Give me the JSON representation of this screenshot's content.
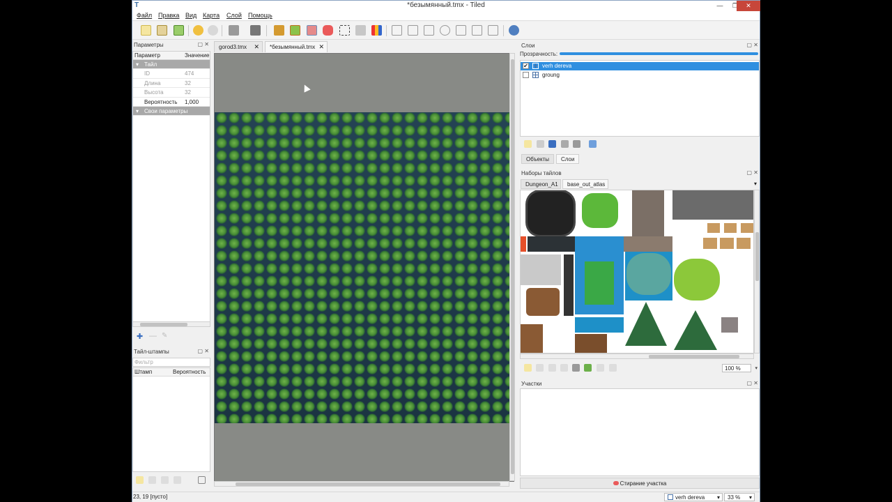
{
  "window": {
    "title": "*безымянный.tmx - Tiled",
    "minimize": "—",
    "maximize": "❐",
    "close": "✕"
  },
  "menu": [
    "Файл",
    "Правка",
    "Вид",
    "Карта",
    "Слой",
    "Помощь"
  ],
  "properties": {
    "title": "Параметры",
    "col_name": "Параметр",
    "col_value": "Значение",
    "group_tile": "Тайл",
    "rows": [
      {
        "name": "ID",
        "value": "474",
        "disabled": true
      },
      {
        "name": "Длина",
        "value": "32",
        "disabled": true
      },
      {
        "name": "Высота",
        "value": "32",
        "disabled": true
      },
      {
        "name": "Вероятность",
        "value": "1,000",
        "disabled": false
      }
    ],
    "group_custom": "Свои параметры"
  },
  "stamps": {
    "title": "Тайл-штампы",
    "filter_placeholder": "Фильтр",
    "col_stamp": "Штамп",
    "col_probability": "Вероятность"
  },
  "documents": {
    "tabs": [
      {
        "label": "gorod3.tmx",
        "active": false
      },
      {
        "label": "*безымянный.tmx",
        "active": true
      }
    ],
    "close_glyph": "✕"
  },
  "layers": {
    "title": "Слои",
    "opacity_label": "Прозрачность:",
    "items": [
      {
        "name": "verh dereva",
        "visible": true,
        "selected": true
      },
      {
        "name": "groung",
        "visible": false,
        "selected": false
      }
    ],
    "bottom_tabs": [
      "Объекты",
      "Слои"
    ]
  },
  "tilesets": {
    "title": "Наборы тайлов",
    "tabs": [
      "Dungeon_A1",
      "base_out_atlas"
    ],
    "zoom": "100 %"
  },
  "terrains": {
    "title": "Участки",
    "erase_label": "Стирание участка"
  },
  "status": {
    "coords": "23, 19 [пусто]",
    "current_layer": "verh dereva",
    "zoom": "33 %"
  },
  "colors": {
    "selection": "#2f8fe0",
    "canvas_bg": "#888a86",
    "tree_green": "#4a8f36",
    "water_blue": "#1e90c8"
  }
}
